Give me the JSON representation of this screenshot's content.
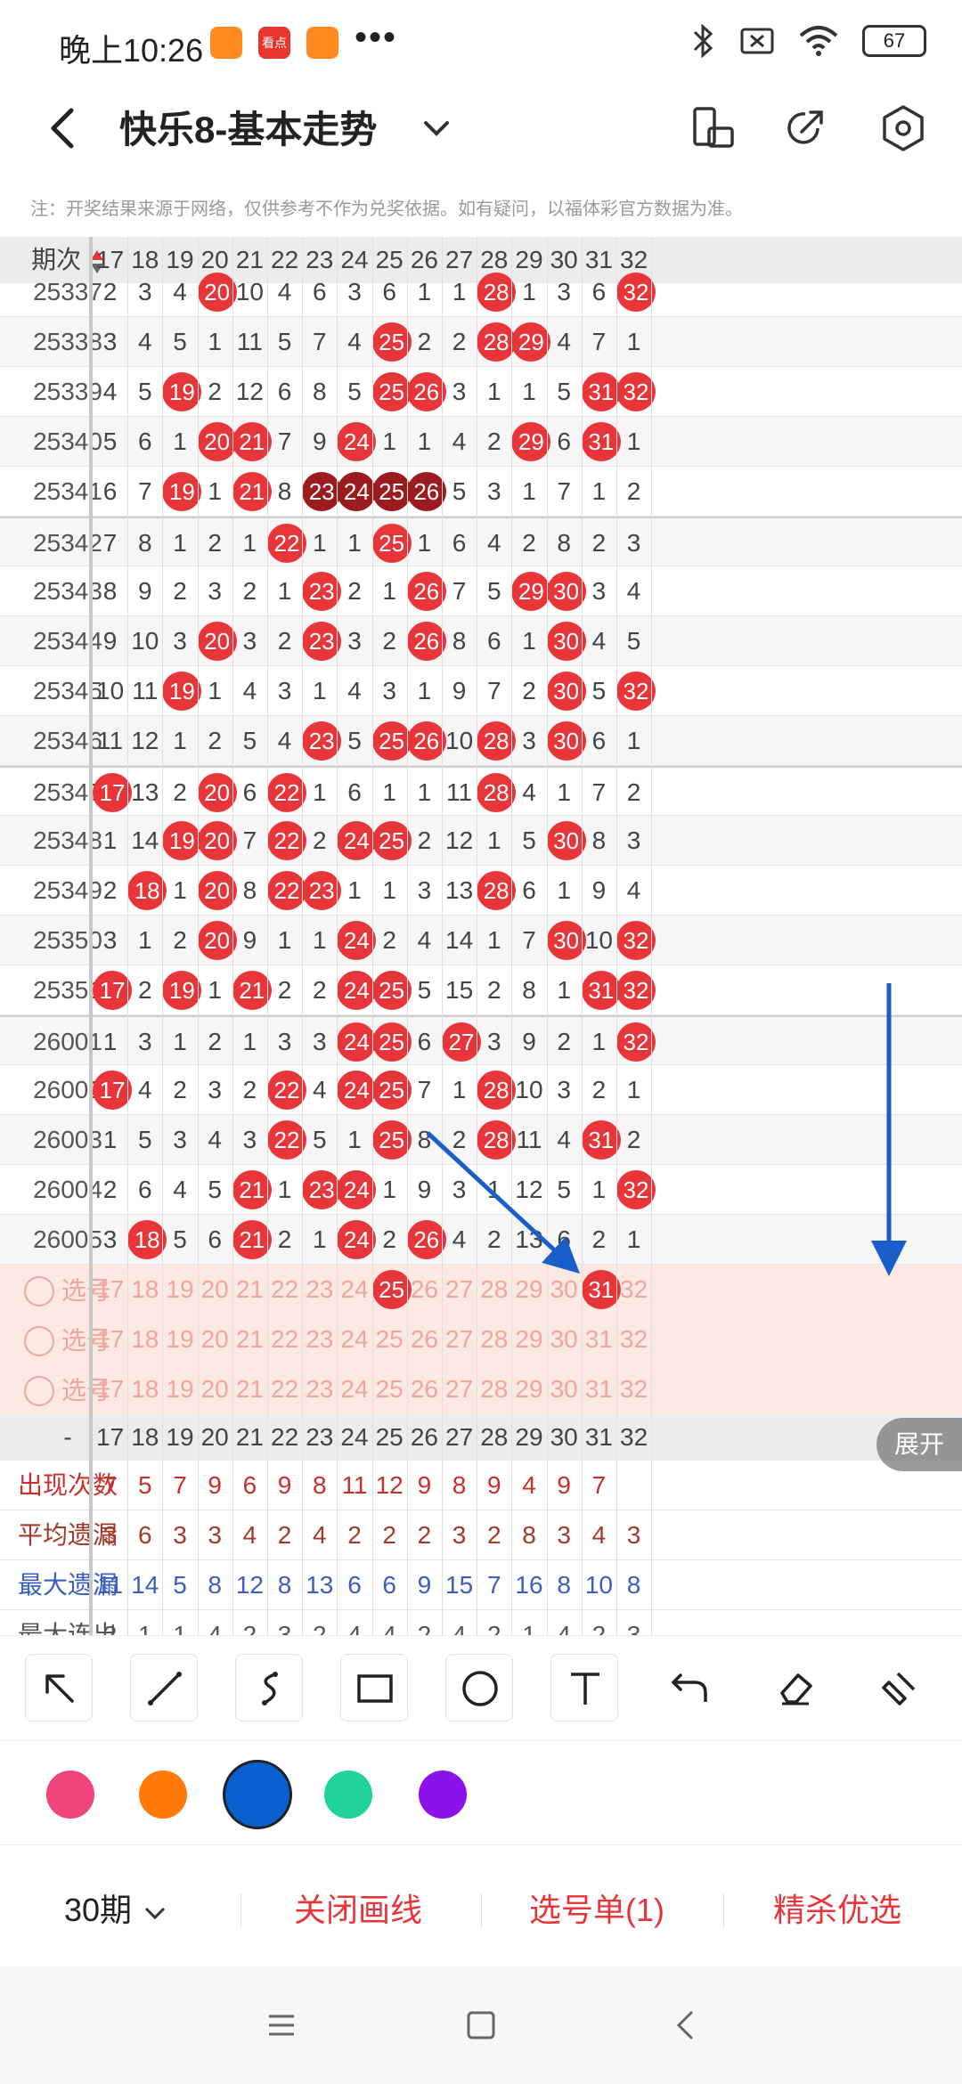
{
  "status": {
    "time": "晚上10:26",
    "app_icons": [
      "",
      "看点",
      ""
    ],
    "more": "•••",
    "battery": "67"
  },
  "header": {
    "title": "快乐8-基本走势"
  },
  "notice": "注：开奖结果来源于网络，仅供参考不作为兑奖依据。如有疑问，以福体彩官方数据为准。",
  "table": {
    "period_header": "期次",
    "columns": [
      "17",
      "18",
      "19",
      "20",
      "21",
      "22",
      "23",
      "24",
      "25",
      "26",
      "27",
      "28",
      "29",
      "30",
      "31",
      "32"
    ],
    "rows": [
      {
        "period": "25337",
        "cells": [
          "2",
          "3",
          "4",
          "20",
          "10",
          "4",
          "6",
          "3",
          "6",
          "1",
          "1",
          "28",
          "1",
          "3",
          "6",
          "32"
        ]
      },
      {
        "period": "25338",
        "cells": [
          "3",
          "4",
          "5",
          "1",
          "11",
          "5",
          "7",
          "4",
          "25",
          "2",
          "2",
          "28",
          "29",
          "4",
          "7",
          "1"
        ]
      },
      {
        "period": "25339",
        "cells": [
          "4",
          "5",
          "19",
          "2",
          "12",
          "6",
          "8",
          "5",
          "25",
          "26",
          "3",
          "1",
          "1",
          "5",
          "31",
          "32"
        ]
      },
      {
        "period": "25340",
        "cells": [
          "5",
          "6",
          "1",
          "20",
          "21",
          "7",
          "9",
          "24",
          "1",
          "1",
          "4",
          "2",
          "29",
          "6",
          "31",
          "1"
        ]
      },
      {
        "period": "25341",
        "cells": [
          "6",
          "7",
          "19",
          "1",
          "21",
          "8",
          "23",
          "24",
          "25",
          "26",
          "5",
          "3",
          "1",
          "7",
          "1",
          "2"
        ]
      },
      {
        "period": "25342",
        "cells": [
          "7",
          "8",
          "1",
          "2",
          "1",
          "22",
          "1",
          "1",
          "25",
          "1",
          "6",
          "4",
          "2",
          "8",
          "2",
          "3"
        ]
      },
      {
        "period": "25343",
        "cells": [
          "8",
          "9",
          "2",
          "3",
          "2",
          "1",
          "23",
          "2",
          "1",
          "26",
          "7",
          "5",
          "29",
          "30",
          "3",
          "4"
        ]
      },
      {
        "period": "25344",
        "cells": [
          "9",
          "10",
          "3",
          "20",
          "3",
          "2",
          "23",
          "3",
          "2",
          "26",
          "8",
          "6",
          "1",
          "30",
          "4",
          "5"
        ]
      },
      {
        "period": "25345",
        "cells": [
          "10",
          "11",
          "19",
          "1",
          "4",
          "3",
          "1",
          "4",
          "3",
          "1",
          "9",
          "7",
          "2",
          "30",
          "5",
          "32"
        ]
      },
      {
        "period": "25346",
        "cells": [
          "11",
          "12",
          "1",
          "2",
          "5",
          "4",
          "23",
          "5",
          "25",
          "26",
          "10",
          "28",
          "3",
          "30",
          "6",
          "1"
        ]
      },
      {
        "period": "25347",
        "cells": [
          "17",
          "13",
          "2",
          "20",
          "6",
          "22",
          "1",
          "6",
          "1",
          "1",
          "11",
          "28",
          "4",
          "1",
          "7",
          "2"
        ]
      },
      {
        "period": "25348",
        "cells": [
          "1",
          "14",
          "19",
          "20",
          "7",
          "22",
          "2",
          "24",
          "25",
          "2",
          "12",
          "1",
          "5",
          "30",
          "8",
          "3"
        ]
      },
      {
        "period": "25349",
        "cells": [
          "2",
          "18",
          "1",
          "20",
          "8",
          "22",
          "23",
          "1",
          "1",
          "3",
          "13",
          "28",
          "6",
          "1",
          "9",
          "4"
        ]
      },
      {
        "period": "25350",
        "cells": [
          "3",
          "1",
          "2",
          "20",
          "9",
          "1",
          "1",
          "24",
          "2",
          "4",
          "14",
          "1",
          "7",
          "30",
          "10",
          "32"
        ]
      },
      {
        "period": "25351",
        "cells": [
          "17",
          "2",
          "19",
          "1",
          "21",
          "2",
          "2",
          "24",
          "25",
          "5",
          "15",
          "2",
          "8",
          "1",
          "31",
          "32"
        ]
      },
      {
        "period": "26001",
        "cells": [
          "1",
          "3",
          "1",
          "2",
          "1",
          "3",
          "3",
          "24",
          "25",
          "6",
          "27",
          "3",
          "9",
          "2",
          "1",
          "32"
        ]
      },
      {
        "period": "26002",
        "cells": [
          "17",
          "4",
          "2",
          "3",
          "2",
          "22",
          "4",
          "24",
          "25",
          "7",
          "1",
          "28",
          "10",
          "3",
          "2",
          "1"
        ]
      },
      {
        "period": "26003",
        "cells": [
          "1",
          "5",
          "3",
          "4",
          "3",
          "22",
          "5",
          "1",
          "25",
          "8",
          "2",
          "28",
          "11",
          "4",
          "31",
          "2"
        ]
      },
      {
        "period": "26004",
        "cells": [
          "2",
          "6",
          "4",
          "5",
          "21",
          "1",
          "23",
          "24",
          "1",
          "9",
          "3",
          "1",
          "12",
          "5",
          "1",
          "32"
        ]
      },
      {
        "period": "26005",
        "cells": [
          "3",
          "18",
          "5",
          "6",
          "21",
          "2",
          "1",
          "24",
          "2",
          "26",
          "4",
          "2",
          "13",
          "6",
          "2",
          "1"
        ]
      }
    ],
    "select_label": "选号",
    "select_rows": 3,
    "footer_header": "-",
    "stats": [
      {
        "label": "出现次数",
        "color": "#c8302b",
        "values": [
          "7",
          "5",
          "7",
          "9",
          "6",
          "9",
          "8",
          "11",
          "12",
          "9",
          "8",
          "9",
          "4",
          "9",
          "7",
          ""
        ]
      },
      {
        "label": "平均遗漏",
        "color": "#a33a2a",
        "values": [
          "3",
          "6",
          "3",
          "3",
          "4",
          "2",
          "4",
          "2",
          "2",
          "2",
          "3",
          "2",
          "8",
          "3",
          "4",
          "3"
        ]
      },
      {
        "label": "最大遗漏",
        "color": "#3b5fc0",
        "values": [
          "11",
          "14",
          "5",
          "8",
          "12",
          "8",
          "13",
          "6",
          "6",
          "9",
          "15",
          "7",
          "16",
          "8",
          "10",
          "8"
        ]
      },
      {
        "label": "最大连出",
        "color": "#555555",
        "values": [
          "2",
          "1",
          "1",
          "4",
          "2",
          "3",
          "2",
          "4",
          "4",
          "2",
          "4",
          "2",
          "1",
          "4",
          "2",
          "3"
        ]
      }
    ],
    "expand_label": "展开"
  },
  "colors": {
    "ball": "#e8353a",
    "ball_dark": "#9c1b1f",
    "arrow": "#1a5fc9",
    "accent": "#e8353a"
  },
  "draw_tools": [
    "arrow-tool-icon",
    "line-tool-icon",
    "curve-tool-icon",
    "rect-tool-icon",
    "circle-tool-icon",
    "text-tool-icon",
    "undo-icon",
    "eraser-icon",
    "clear-icon"
  ],
  "swatches": [
    "#f0457a",
    "#ff7a0a",
    "#0a5fcf",
    "#1fd39a",
    "#8c12ea"
  ],
  "bottom": {
    "periods": "30期",
    "close_lines": "关闭画线",
    "selection": "选号单(1)",
    "premium": "精杀优选"
  }
}
